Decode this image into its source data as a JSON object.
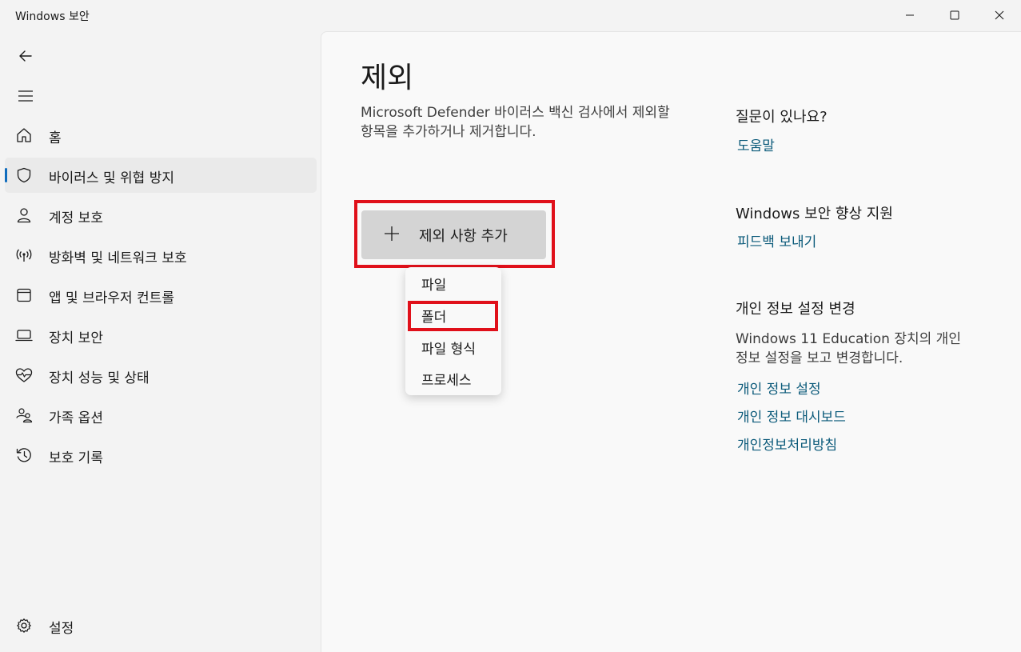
{
  "window": {
    "title": "Windows 보안"
  },
  "sidebar": {
    "items": [
      {
        "label": "홈",
        "icon": "home-icon"
      },
      {
        "label": "바이러스 및 위협 방지",
        "icon": "shield-icon",
        "selected": true
      },
      {
        "label": "계정 보호",
        "icon": "person-icon"
      },
      {
        "label": "방화벽 및 네트워크 보호",
        "icon": "wireless-icon"
      },
      {
        "label": "앱 및 브라우저 컨트롤",
        "icon": "browser-window-icon"
      },
      {
        "label": "장치 보안",
        "icon": "laptop-icon"
      },
      {
        "label": "장치 성능 및 상태",
        "icon": "heart-pulse-icon"
      },
      {
        "label": "가족 옵션",
        "icon": "family-icon"
      },
      {
        "label": "보호 기록",
        "icon": "history-icon"
      }
    ],
    "settings_label": "설정"
  },
  "main": {
    "title": "제외",
    "description": "Microsoft Defender 바이러스 백신 검사에서 제외할 항목을 추가하거나 제거합니다.",
    "add_button_label": "제외 사항 추가",
    "menu_items": [
      "파일",
      "폴더",
      "파일 형식",
      "프로세스"
    ]
  },
  "right": {
    "help_heading": "질문이 있나요?",
    "help_link": "도움말",
    "improve_heading": "Windows 보안 향상 지원",
    "feedback_link": "피드백 보내기",
    "privacy_heading": "개인 정보 설정 변경",
    "privacy_text": "Windows 11 Education 장치의 개인 정보 설정을 보고 변경합니다.",
    "privacy_links": [
      "개인 정보 설정",
      "개인 정보 대시보드",
      "개인정보처리방침"
    ]
  },
  "colors": {
    "accent": "#0f6cbd",
    "link": "#0b5a7a",
    "highlight": "#e0101a"
  }
}
